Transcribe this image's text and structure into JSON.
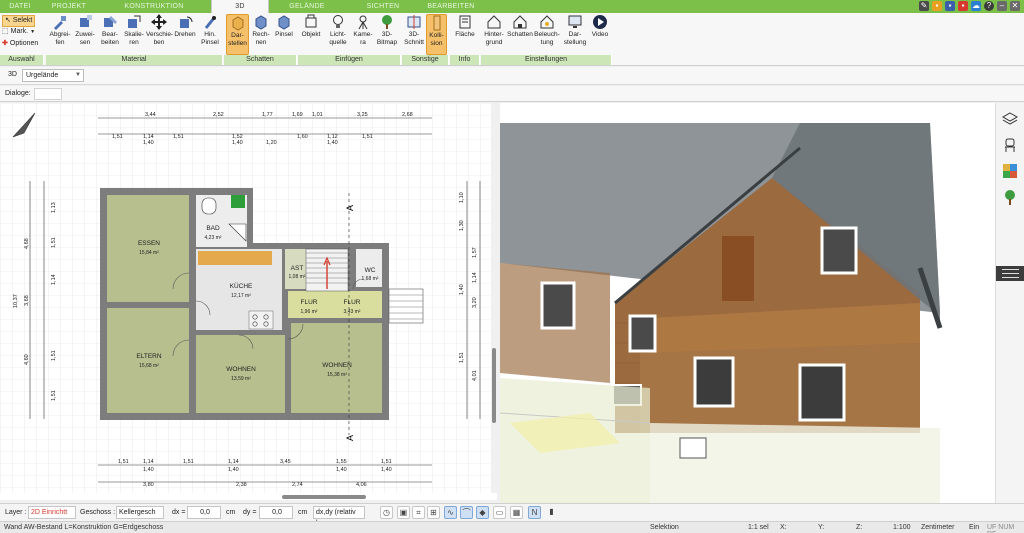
{
  "tabs": [
    "DATEI",
    "PROJEKT",
    "KONSTRUKTION",
    "3D",
    "GELÄNDE",
    "SICHTEN",
    "BEARBEITEN"
  ],
  "active_tab": "3D",
  "accent_color": "#7cc04a",
  "selection": {
    "items": [
      "Selekt",
      "Mark.",
      "Optionen"
    ],
    "group": "Auswahl"
  },
  "ribbon": {
    "material": {
      "group": "Material",
      "buttons": [
        "Abgrei-\nfen",
        "Zuwei-\nsen",
        "Bear-\nbeiten",
        "Skalie-\nren",
        "Verschie-\nben",
        "Drehen",
        "Hin.\nPinsel"
      ]
    },
    "schatten": {
      "group": "Schatten",
      "buttons": [
        "Dar-\nstellen",
        "Rech-\nnen",
        "Pinsel"
      ]
    },
    "einfuegen": {
      "group": "Einfügen",
      "buttons": [
        "Objekt",
        "Licht-\nquelle",
        "Kame-\nra",
        "3D-\nBitmap"
      ]
    },
    "sonstige": {
      "group": "Sonstige",
      "buttons": [
        "3D-\nSchnitt",
        "Kolli-\nsion"
      ]
    },
    "info": {
      "group": "Info",
      "buttons": [
        "Fläche"
      ]
    },
    "einstellungen": {
      "group": "Einstellungen",
      "buttons": [
        "Hinter-\ngrund",
        "Schatten",
        "Beleuch-\ntung",
        "Dar-\nstellung",
        "Video"
      ]
    }
  },
  "view": {
    "mode": "3D",
    "terrain": "Urgelände"
  },
  "dialog_label": "Dialoge:",
  "rooms": [
    {
      "name": "ESSEN",
      "area": "15,84 m²"
    },
    {
      "name": "BAD",
      "area": "4,23 m²"
    },
    {
      "name": "KÜCHE",
      "area": "12,17 m²"
    },
    {
      "name": "AST",
      "area": "1,08 m²"
    },
    {
      "name": "WC",
      "area": "1,68 m²"
    },
    {
      "name": "FLUR",
      "area": "1,96 m²"
    },
    {
      "name": "FLUR",
      "area": "3,43 m²"
    },
    {
      "name": "ELTERN",
      "area": "15,68 m²"
    },
    {
      "name": "WOHNEN",
      "area": "13,59 m²"
    },
    {
      "name": "WOHNEN",
      "area": "15,38 m²"
    }
  ],
  "section_marker": "A",
  "dims": {
    "top1": [
      "3,44",
      "2,52",
      "1,77",
      "1,69",
      "1,01",
      "3,25",
      "2,68"
    ],
    "top2": [
      "1,51",
      "1,14",
      "1,51",
      "1,52",
      "1,60",
      "1,12",
      "1,51"
    ],
    "top2_sub": [
      "1,40",
      "1,40",
      "1,20",
      "1,40"
    ],
    "bottom1": [
      "1,51",
      "1,14",
      "1,51",
      "1,14",
      "3,45",
      "1,55",
      "1,51"
    ],
    "bottom1_sub": [
      "1,40",
      "1,40",
      "1,40",
      "1,40"
    ],
    "bottom2": [
      "3,80",
      "2,38",
      "2,74",
      "4,06"
    ],
    "left_outer": "10,37",
    "left1": [
      "4,68",
      "3,68",
      "4,60"
    ],
    "left2": [
      "1,13",
      "1,51",
      "1,14",
      "1,51",
      "1,51"
    ],
    "right1": [
      "1,57",
      "1,14",
      "3,20",
      "4,01"
    ],
    "right2": [
      "1,10",
      "1,30",
      "1,40",
      "1,51"
    ]
  },
  "bottombar": {
    "layer_label": "Layer :",
    "layer_value": "2D Einrichtt",
    "geschoss_label": "Geschoss :",
    "geschoss_value": "Kellergesch",
    "dx_label": "dx =",
    "dx_value": "0,0",
    "dy_label": "dy =",
    "dy_value": "0,0",
    "unit": "cm",
    "mode": "dx,dy (relativ kar"
  },
  "statusbar": {
    "left": "Wand AW-Bestand L=Konstruktion G=Erdgeschoss",
    "mode": "Selektion",
    "sel": "1:1 sel",
    "x": "X:",
    "y": "Y:",
    "z": "Z:",
    "scale": "1:100",
    "unit": "Zentimeter",
    "ein": "Ein",
    "flags": "UF NUM RF"
  }
}
